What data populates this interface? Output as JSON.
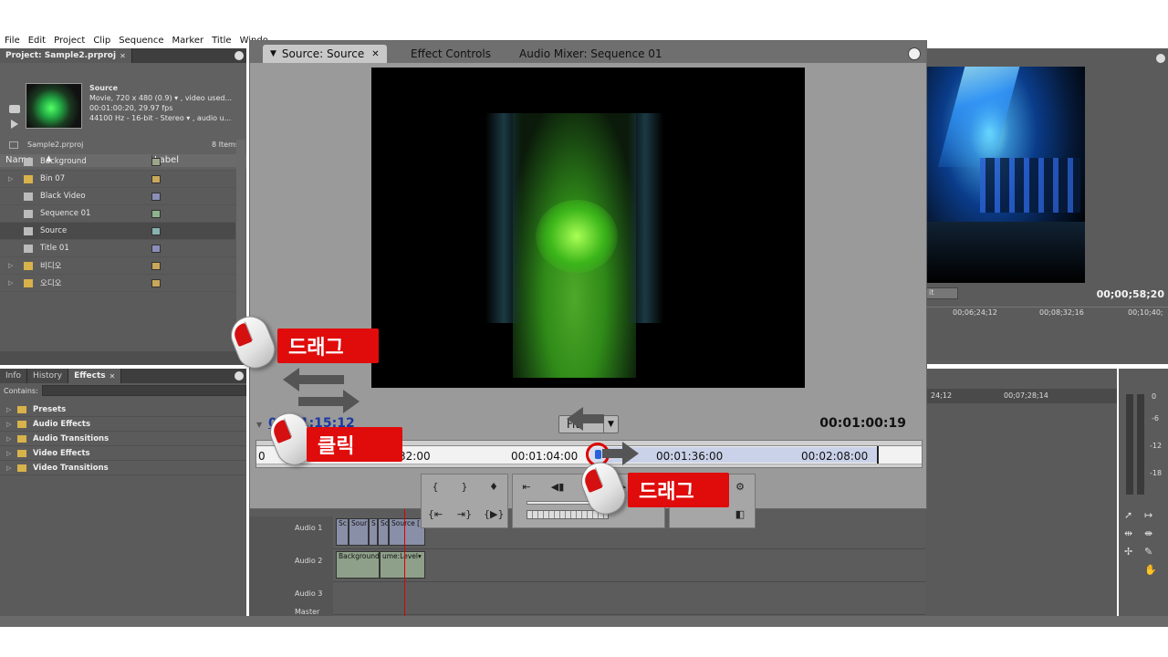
{
  "menu": [
    "File",
    "Edit",
    "Project",
    "Clip",
    "Sequence",
    "Marker",
    "Title",
    "Windo"
  ],
  "project": {
    "tab": "Project: Sample2.prproj",
    "clip_name": "Source",
    "meta1": "Movie, 720 x 480 (0.9)  ▾ , video used...",
    "meta2": "00:01:00:20, 29.97 fps",
    "meta3": "44100 Hz - 16-bit - Stereo  ▾ , audio u...",
    "file": "Sample2.prproj",
    "count": "8 Items",
    "col_name": "Name",
    "col_label": "Label",
    "items": [
      {
        "name": "Background",
        "type": "audio",
        "color": "#9aa58a"
      },
      {
        "name": "Bin 07",
        "type": "folder",
        "color": "#c9a85a"
      },
      {
        "name": "Black Video",
        "type": "clip",
        "color": "#8b8fb8"
      },
      {
        "name": "Sequence 01",
        "type": "clip",
        "color": "#8fb38f"
      },
      {
        "name": "Source",
        "type": "clip",
        "color": "#8ab2b0",
        "selected": true
      },
      {
        "name": "Title 01",
        "type": "clip",
        "color": "#8b8fb8"
      },
      {
        "name": "비디오",
        "type": "folder",
        "color": "#c9a85a"
      },
      {
        "name": "오디오",
        "type": "folder",
        "color": "#c9a85a"
      }
    ]
  },
  "effects_panel": {
    "tabs": [
      "Info",
      "History",
      "Effects"
    ],
    "contains_label": "Contains:",
    "items": [
      "Presets",
      "Audio Effects",
      "Audio Transitions",
      "Video Effects",
      "Video Transitions"
    ]
  },
  "source": {
    "tabs": [
      "Source: Source",
      "Effect Controls",
      "Audio Mixer: Sequence 01"
    ],
    "tc_current": "00:01:15:12",
    "tc_duration": "00:01:00:19",
    "fit": "Fit",
    "ruler_labels": [
      "0",
      "32:00",
      "00:01:04:00",
      "00:01:36:00",
      "00:02:08:00"
    ]
  },
  "program": {
    "timecode": "00;00;58;20",
    "fit": "it",
    "ruler": [
      "00;06;24;12",
      "00;08;32;16",
      "00;10;40;"
    ]
  },
  "timeline": {
    "ruler": [
      "24;12",
      "00;07;28;14"
    ],
    "tracks": [
      {
        "name": "Audio 1",
        "clips": [
          "Sou",
          "Sour",
          "S",
          "Source [",
          "Sc"
        ]
      },
      {
        "name": "Audio 2",
        "clips": [
          "Background",
          "ume:Level▾"
        ]
      },
      {
        "name": "Audio 3",
        "clips": []
      },
      {
        "name": "Master",
        "clips": []
      }
    ]
  },
  "meters": {
    "labels": [
      "0",
      "-6",
      "-12",
      "-18"
    ]
  },
  "annotations": {
    "drag_top": "드래그",
    "click": "클릭",
    "drag_bottom": "드래그"
  },
  "colors": {
    "callout": "#e00b0b",
    "panel": "#5b5b5b",
    "monitor": "#9a9a9a",
    "timecode_link": "#1b3aa0"
  }
}
